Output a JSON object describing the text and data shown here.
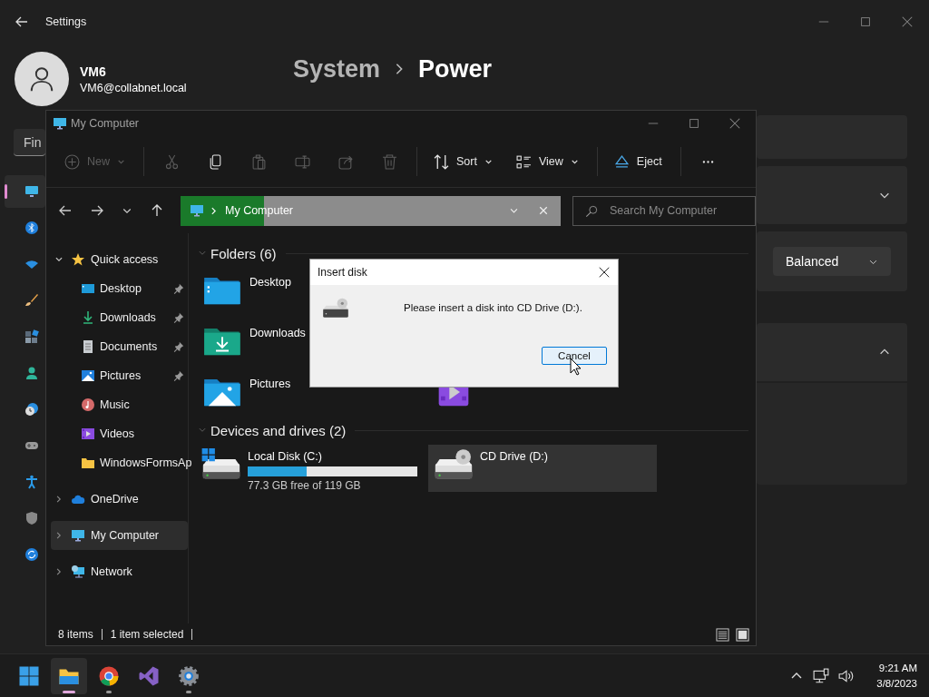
{
  "settings": {
    "title": "Settings",
    "user": {
      "name": "VM6",
      "email": "VM6@collabnet.local"
    },
    "breadcrumb": [
      {
        "label": "System",
        "current": false
      },
      {
        "label": "Power",
        "current": true
      }
    ],
    "search": {
      "placeholder": "Fin"
    },
    "nav": [
      {
        "kind": "display",
        "selected": true
      },
      {
        "kind": "bluetooth",
        "selected": false
      },
      {
        "kind": "wifi",
        "selected": false
      },
      {
        "kind": "brush",
        "selected": false
      },
      {
        "kind": "apps",
        "selected": false
      },
      {
        "kind": "person",
        "selected": false
      },
      {
        "kind": "clock",
        "selected": false
      },
      {
        "kind": "gamepad",
        "selected": false
      },
      {
        "kind": "accessibility",
        "selected": false
      },
      {
        "kind": "shield",
        "selected": false
      },
      {
        "kind": "update",
        "selected": false
      }
    ],
    "cards": [
      {
        "kind": "plain"
      },
      {
        "kind": "collapsed"
      },
      {
        "kind": "dropdown",
        "value": "Balanced"
      },
      {
        "kind": "expanded"
      }
    ]
  },
  "explorer": {
    "title": "My Computer",
    "toolbar": [
      {
        "kind": "new",
        "label": "New",
        "disabled": true,
        "dropdown": true
      },
      {
        "kind": "separator"
      },
      {
        "kind": "cut",
        "disabled": true
      },
      {
        "kind": "copy",
        "disabled": false
      },
      {
        "kind": "paste",
        "disabled": true
      },
      {
        "kind": "rename",
        "disabled": true
      },
      {
        "kind": "share",
        "disabled": true
      },
      {
        "kind": "delete",
        "disabled": true
      },
      {
        "kind": "separator"
      },
      {
        "kind": "sort",
        "label": "Sort",
        "disabled": false,
        "dropdown": true
      },
      {
        "kind": "view",
        "label": "View",
        "disabled": false,
        "dropdown": true
      },
      {
        "kind": "separator"
      },
      {
        "kind": "eject",
        "label": "Eject",
        "disabled": false
      },
      {
        "kind": "separator"
      },
      {
        "kind": "more",
        "disabled": false
      }
    ],
    "address": {
      "path": "My Computer",
      "level": 0.22
    },
    "search": {
      "placeholder": "Search My Computer"
    },
    "navigation": [
      {
        "kind": "quick",
        "label": "Quick access",
        "expanded": true,
        "selected": false,
        "children": [
          {
            "kind": "desktop",
            "label": "Desktop",
            "pinned": true,
            "selected": false
          },
          {
            "kind": "downloads",
            "label": "Downloads",
            "pinned": true,
            "selected": false
          },
          {
            "kind": "documents",
            "label": "Documents",
            "pinned": true,
            "selected": false
          },
          {
            "kind": "pictures",
            "label": "Pictures",
            "pinned": true,
            "selected": false
          },
          {
            "kind": "music",
            "label": "Music",
            "pinned": false,
            "selected": false
          },
          {
            "kind": "videos",
            "label": "Videos",
            "pinned": false,
            "selected": false
          },
          {
            "kind": "folder",
            "label": "WindowsFormsAp",
            "pinned": false,
            "selected": false
          }
        ]
      },
      {
        "kind": "onedrive",
        "label": "OneDrive",
        "expanded": false,
        "selected": false
      },
      {
        "kind": "computer",
        "label": "My Computer",
        "expanded": false,
        "selected": true
      },
      {
        "kind": "network",
        "label": "Network",
        "expanded": false,
        "selected": false
      }
    ],
    "folders": {
      "title": "Folders (6)",
      "expanded": true,
      "rows": [
        [
          {
            "kind": "desktop",
            "label": "Desktop"
          }
        ],
        [
          {
            "kind": "downloads",
            "label": "Downloads"
          }
        ],
        [
          {
            "kind": "pictures",
            "label": "Pictures"
          },
          {
            "kind": "videos"
          }
        ]
      ]
    },
    "drives": {
      "title": "Devices and drives (2)",
      "expanded": true,
      "items": [
        {
          "kind": "system",
          "label": "Local Disk (C:)",
          "level": 0.35,
          "detail": "77.3 GB free of 119 GB",
          "selected": false
        },
        {
          "kind": "cd",
          "label": "CD Drive (D:)",
          "selected": true
        }
      ]
    },
    "status": [
      "8 items",
      "1 item selected"
    ],
    "views": [
      {
        "kind": "details",
        "selected": false
      },
      {
        "kind": "tiles",
        "selected": true
      }
    ]
  },
  "dialog": {
    "title": "Insert disk",
    "message": "Please insert a disk into CD Drive (D:).",
    "buttons": [
      {
        "label": "Cancel",
        "focused": true
      }
    ]
  },
  "taskbar": {
    "apps": [
      {
        "kind": "start",
        "active": false,
        "running": false
      },
      {
        "kind": "explorer",
        "active": true,
        "running": true
      },
      {
        "kind": "chrome",
        "active": false,
        "running": true
      },
      {
        "kind": "vs",
        "active": false,
        "running": false
      },
      {
        "kind": "settings",
        "active": false,
        "running": true
      }
    ],
    "time": "9:21 AM",
    "date": "3/8/2023"
  }
}
